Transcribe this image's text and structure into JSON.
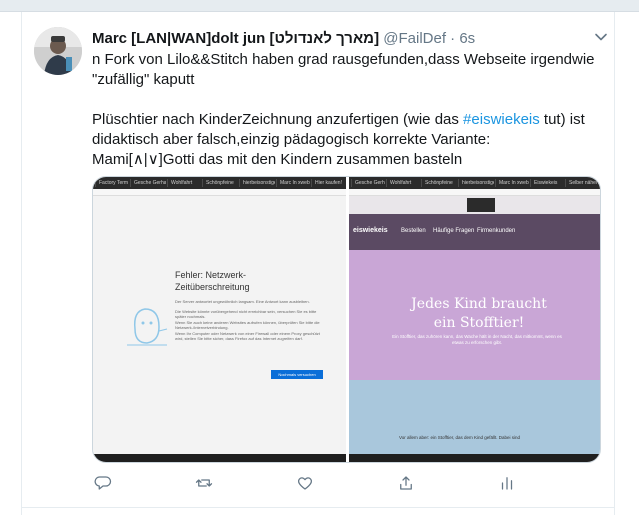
{
  "tweet": {
    "author_name": "Marc [LAN|WAN]dolt jun [מארך לאנדולט]",
    "handle": "@FailDef",
    "separator": "·",
    "time": "6s",
    "lines": [
      "n Fork von Lilo&&Stitch haben grad rausgefunden,dass Webseite irgendwie",
      "\"zufällig\" kaputt"
    ],
    "para2_line1_pre": "Plüschtier nach KinderZeichnung anzufertigen (wie das ",
    "hashtag": "#eiswiekeis",
    "para2_line1_post": " tut) ist",
    "para2_line2": "didaktisch aber falsch,einzig pädagogisch korrekte Variante:",
    "para2_line3": "Mami[∧|∨]Gotti das mit den Kindern zusammen basteln"
  },
  "media": {
    "left": {
      "tabs": [
        "Factory Term",
        "Gesche Gerhard",
        "Wohlfahrt",
        "Schönpfeine",
        "hierbeisonstiges",
        "Marc In xweb",
        "Hier kaufen!"
      ],
      "error_title": "Fehler: Netzwerk-Zeitüberschreitung",
      "error_body": [
        "Der Server antwortet ungewöhnlich langsam. Eine Antwort kann ausbleiben.",
        "Die Website könnte vorübergehend nicht erreichbar sein, versuchen Sie es bitte später nochmals.",
        "Wenn Sie auch keine anderen Websites aufrufen können, überprüfen Sie bitte die Netzwerk-/Internetverbindung.",
        "Wenn Ihr Computer oder Netzwerk von einer Firewall oder einem Proxy geschützt wird, stellen Sie bitte sicher, dass Firefox auf das Internet zugreifen darf."
      ],
      "retry_label": "Nochmals versuchen"
    },
    "right": {
      "tabs": [
        "Gesche Gerhard",
        "Wohlfahrt",
        "Schönpfeine",
        "hierbeisonstiges",
        "Marc In xweb",
        "Eiswiekeis",
        "Selber nähen"
      ],
      "logo": "eiswiekeis",
      "nav": [
        "Bestellen",
        "Häufige Fragen",
        "Firmenkunden"
      ],
      "hero_line1": "Jedes Kind braucht",
      "hero_line2": "ein Stofftier!",
      "hero_sub": "Ein Stofftier, das zuhören kann, das Wache hält in der Nacht, das mitkommt, wenn es etwas zu erforschen gibt.",
      "bottom_text": "Vor allem aber: ein Stofftier, das dem Kind gefällt. Dabei sind"
    }
  },
  "actions": {
    "icons": [
      "reply-icon",
      "retweet-icon",
      "like-icon",
      "share-icon",
      "analytics-icon"
    ]
  },
  "colors": {
    "text": "#14171a",
    "muted": "#657786",
    "link": "#1b95e0"
  }
}
